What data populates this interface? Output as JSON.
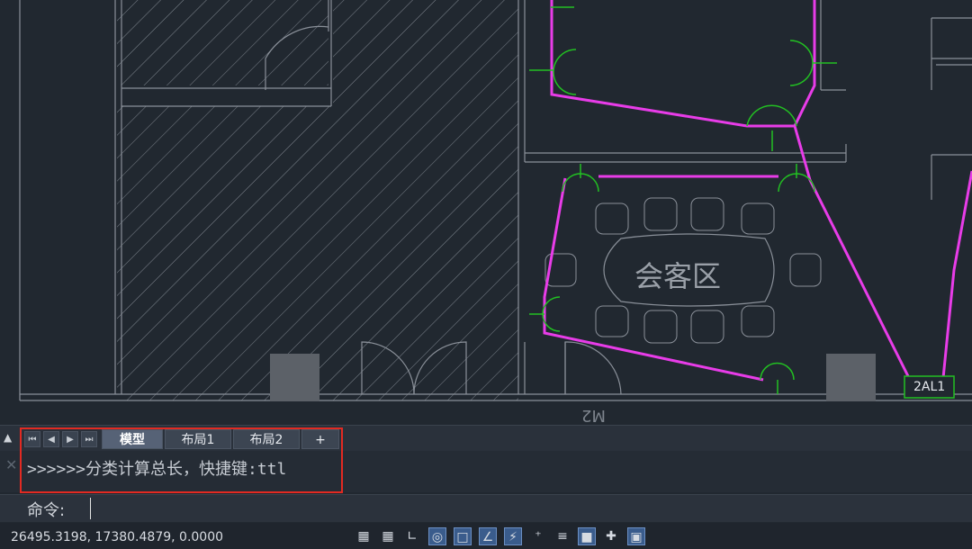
{
  "canvas": {
    "room_label": "会客区",
    "panel_tag": "2AL1",
    "door_tag": "M2"
  },
  "tabs": {
    "model": "模型",
    "layout1": "布局1",
    "layout2": "布局2",
    "add": "+"
  },
  "command_history": {
    "line": ">>>>>>分类计算总长，快捷键:ttl"
  },
  "command_line": {
    "prompt": "命令:",
    "value": ""
  },
  "status": {
    "coordinates": "26495.3198, 17380.4879, 0.0000"
  },
  "colors": {
    "background": "#212830",
    "polyline": "#e83ce8",
    "chair_green": "#22c022",
    "wall_gray": "#8a9099",
    "highlight": "#e22a22"
  }
}
